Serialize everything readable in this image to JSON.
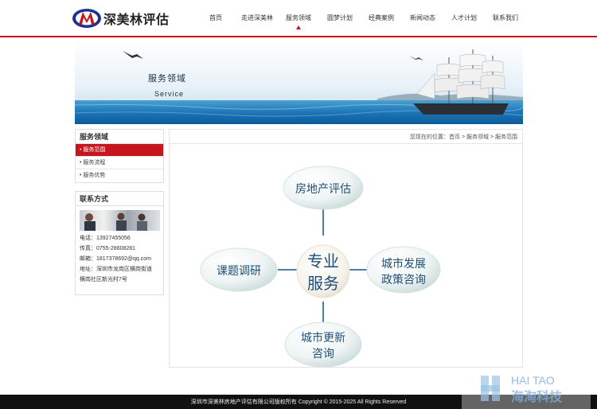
{
  "header": {
    "logo_text": "深美林评估",
    "nav": [
      "首页",
      "走进深美林",
      "服务领域",
      "圆梦计划",
      "经典案例",
      "新闻动态",
      "人才计划",
      "联系我们"
    ],
    "active_nav_index": 2
  },
  "banner": {
    "title": "服务领域",
    "subtitle": "Service"
  },
  "sidebar": {
    "title": "服务领域",
    "items": [
      {
        "label": "• 服务范围",
        "active": true
      },
      {
        "label": "• 服务流程",
        "active": false
      },
      {
        "label": "• 服务优势",
        "active": false
      }
    ]
  },
  "contact": {
    "title": "联系方式",
    "phone": "电话：13927455056",
    "fax": "传真：0755-28608281",
    "email": "邮箱：1817378692@qq.com",
    "address_1": "地址：深圳市龙岗区横岗街道",
    "address_2": "横岗社区新光村7号"
  },
  "content": {
    "breadcrumb": "您现在的位置：首页 > 服务领域 > 服务范围",
    "diagram": {
      "center_1": "专业",
      "center_2": "服务",
      "top": "房地产评估",
      "left": "课题调研",
      "right_1": "城市发展",
      "right_2": "政策咨询",
      "bottom_1": "城市更新",
      "bottom_2": "咨询"
    }
  },
  "footer": {
    "copyright": "深圳市深美林房地产评估有限公司版权所有 Copyright © 2015-2025 All Rights Reserved"
  },
  "watermark": {
    "line_1": "HAI TAO",
    "line_2": "海淘科技"
  },
  "colors": {
    "accent": "#c4161c",
    "footer": "#111111",
    "diagram_text": "#1e4e78"
  }
}
